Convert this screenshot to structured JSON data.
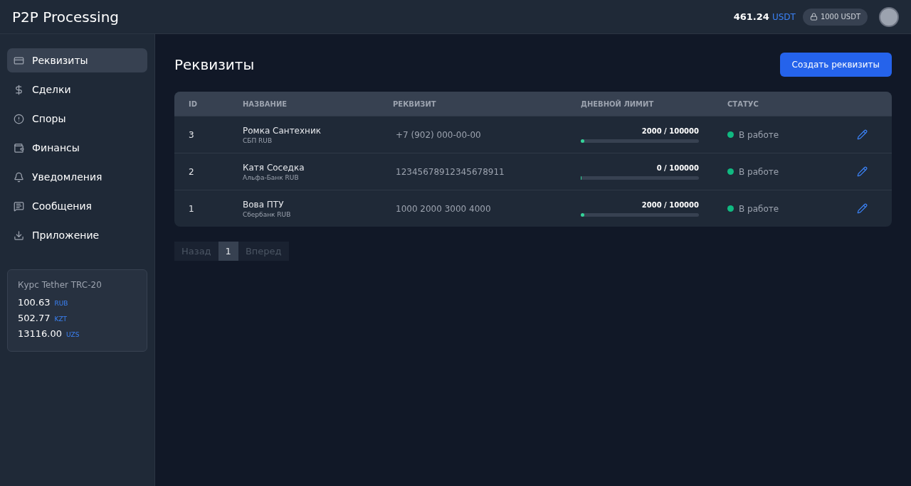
{
  "header": {
    "logo": "P2P Processing",
    "balance": {
      "amount": "461.24",
      "currency": "USDT"
    },
    "frozen": "1000 USDT"
  },
  "sidebar": {
    "items": [
      {
        "label": "Реквизиты",
        "selected": true
      },
      {
        "label": "Сделки",
        "selected": false
      },
      {
        "label": "Споры",
        "selected": false
      },
      {
        "label": "Финансы",
        "selected": false
      },
      {
        "label": "Уведомления",
        "selected": false
      },
      {
        "label": "Сообщения",
        "selected": false
      },
      {
        "label": "Приложение",
        "selected": false
      }
    ],
    "rates": {
      "title": "Курс Tether TRC-20",
      "items": [
        {
          "value": "100.63",
          "currency": "RUB"
        },
        {
          "value": "502.77",
          "currency": "KZT"
        },
        {
          "value": "13116.00",
          "currency": "UZS"
        }
      ]
    }
  },
  "page": {
    "title": "Реквизиты",
    "create_button": "Создать реквизиты"
  },
  "table": {
    "columns": [
      "ID",
      "НАЗВАНИЕ",
      "РЕКВИЗИТ",
      "ДНЕВНОЙ ЛИМИТ",
      "СТАТУС"
    ],
    "rows": [
      {
        "id": "3",
        "name": "Ромка Сантехник",
        "bank": "СБП RUB",
        "requisite": "+7 (902) 000-00-00",
        "limit": "2000 / 100000",
        "level": 0.02,
        "status": "В работе",
        "color": "#10b981"
      },
      {
        "id": "2",
        "name": "Катя Соседка",
        "bank": "Альфа-Банк RUB",
        "requisite": "12345678912345678911",
        "limit": "0 / 100000",
        "level": 0,
        "status": "В работе",
        "color": "#10b981"
      },
      {
        "id": "1",
        "name": "Вова ПТУ",
        "bank": "Сбербанк RUB",
        "requisite": "1000 2000 3000 4000",
        "limit": "2000 / 100000",
        "level": 0.02,
        "status": "В работе",
        "color": "#10b981"
      }
    ]
  },
  "pagination": {
    "prev": {
      "label": "Назад",
      "disabled": true
    },
    "pages": [
      {
        "label": "1",
        "selected": true
      }
    ],
    "next": {
      "label": "Вперед",
      "disabled": true
    }
  }
}
